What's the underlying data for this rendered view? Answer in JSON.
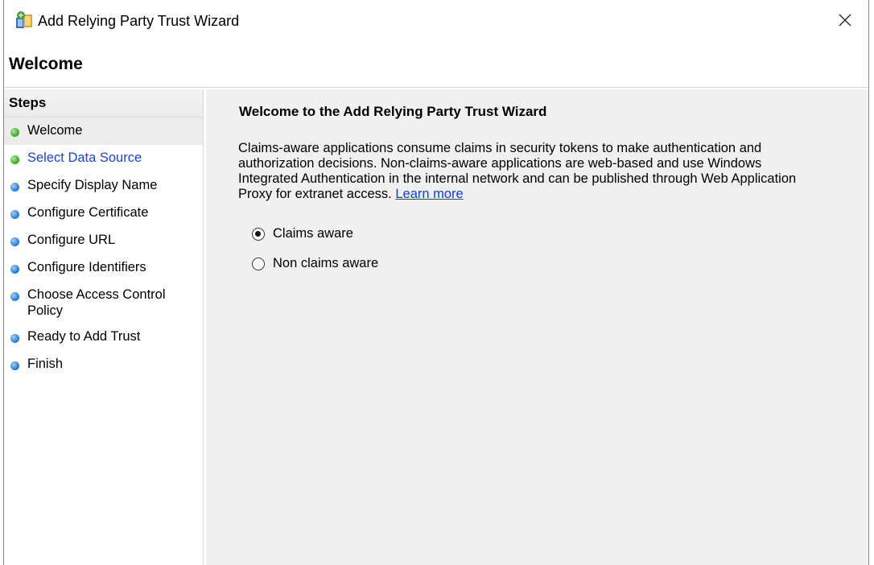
{
  "window": {
    "title": "Add Relying Party Trust Wizard",
    "close_glyph": "✕",
    "icon": "wizard-app-icon"
  },
  "header": {
    "title": "Welcome"
  },
  "sidebar": {
    "heading": "Steps",
    "items": [
      {
        "label": "Welcome",
        "status": "green",
        "state": "current"
      },
      {
        "label": "Select Data Source",
        "status": "green",
        "state": "link"
      },
      {
        "label": "Specify Display Name",
        "status": "blue",
        "state": "normal"
      },
      {
        "label": "Configure Certificate",
        "status": "blue",
        "state": "normal"
      },
      {
        "label": "Configure URL",
        "status": "blue",
        "state": "normal"
      },
      {
        "label": "Configure Identifiers",
        "status": "blue",
        "state": "normal"
      },
      {
        "label": "Choose Access Control Policy",
        "status": "blue",
        "state": "normal"
      },
      {
        "label": "Ready to Add Trust",
        "status": "blue",
        "state": "normal"
      },
      {
        "label": "Finish",
        "status": "blue",
        "state": "normal"
      }
    ]
  },
  "main": {
    "title": "Welcome to the Add Relying Party Trust Wizard",
    "description": "Claims-aware applications consume claims in security tokens to make authentication and authorization decisions. Non-claims-aware applications are web-based and use Windows Integrated Authentication in the internal network and can be published through Web Application Proxy for extranet access.",
    "learn_more": "Learn more",
    "options": [
      {
        "label": "Claims aware",
        "checked": true
      },
      {
        "label": "Non claims aware",
        "checked": false
      }
    ]
  },
  "colors": {
    "link": "#1f3fd6",
    "panel_bg": "#f0f0f0",
    "status_green": "#3fb02c",
    "status_blue": "#2d7fe0"
  }
}
